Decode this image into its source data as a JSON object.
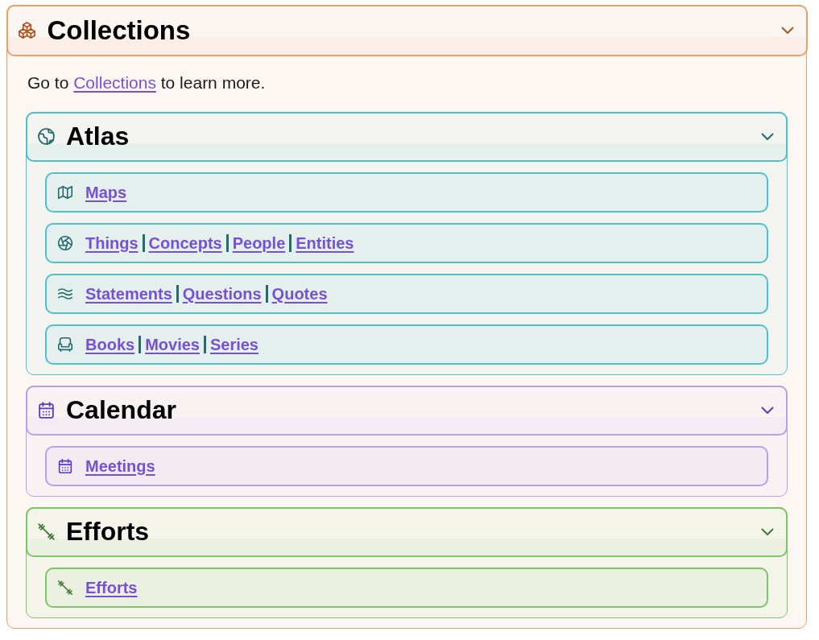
{
  "panel": {
    "title": "Collections",
    "expanded": true
  },
  "intro": {
    "before": "Go to",
    "link": "Collections",
    "after": "to learn more."
  },
  "sections": [
    {
      "title": "Atlas",
      "expanded": true,
      "color": "#4ec1c8",
      "rows": [
        {
          "links": [
            "Maps"
          ]
        },
        {
          "links": [
            "Things",
            "Concepts",
            "People",
            "Entities"
          ]
        },
        {
          "links": [
            "Statements",
            "Questions",
            "Quotes"
          ]
        },
        {
          "links": [
            "Books",
            "Movies",
            "Series"
          ]
        }
      ]
    },
    {
      "title": "Calendar",
      "expanded": true,
      "color": "#b3a4ea",
      "rows": [
        {
          "links": [
            "Meetings"
          ]
        }
      ]
    },
    {
      "title": "Efforts",
      "expanded": true,
      "color": "#7cc36a",
      "rows": [
        {
          "links": [
            "Efforts"
          ]
        }
      ]
    }
  ]
}
